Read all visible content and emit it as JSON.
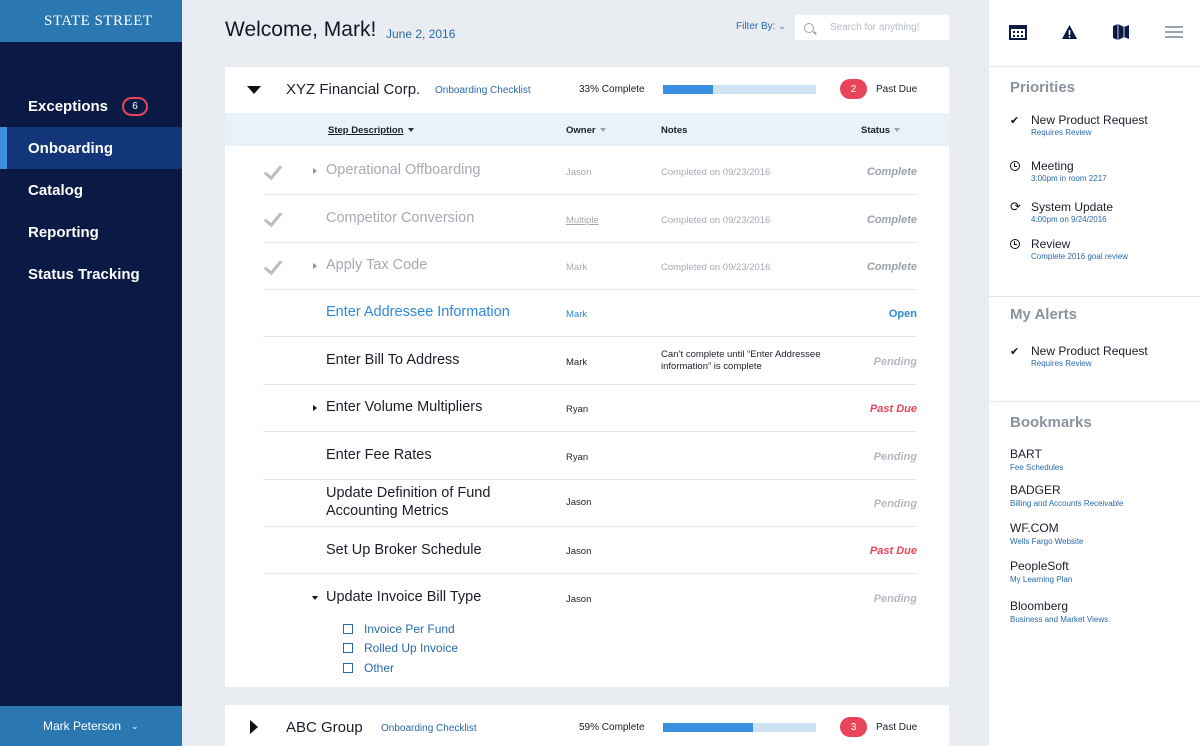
{
  "sidebar": {
    "logo": "STATE STREET",
    "items": [
      {
        "label": "Exceptions",
        "badge": "6"
      },
      {
        "label": "Onboarding"
      },
      {
        "label": "Catalog"
      },
      {
        "label": "Reporting"
      },
      {
        "label": "Status Tracking"
      }
    ],
    "active_item": "Onboarding",
    "user": "Mark Peterson"
  },
  "header": {
    "welcome": "Welcome, Mark!",
    "date": "June 2, 2016",
    "filter_label": "Filter By:",
    "search_placeholder": "Search for anything!"
  },
  "cards": [
    {
      "company": "XYZ Financial Corp.",
      "checklist_link": "Onboarding Checklist",
      "progress_text": "33% Complete",
      "progress": 0.33,
      "past_due_count": "2",
      "past_due_label": "Past Due",
      "expanded": true
    },
    {
      "company": "ABC Group",
      "checklist_link": "Onboarding Checklist",
      "progress_text": "59% Complete",
      "progress": 0.59,
      "past_due_count": "3",
      "past_due_label": "Past Due",
      "expanded": false
    }
  ],
  "table": {
    "columns": {
      "step": "Step Description",
      "owner": "Owner",
      "notes": "Notes",
      "status": "Status"
    },
    "rows": [
      {
        "step": "Operational Offboarding",
        "owner": "Jason",
        "notes": "Completed on 09/23/2016",
        "status": "Complete"
      },
      {
        "step": "Competitor Conversion",
        "owner": "Multiple",
        "notes": "Completed on 09/23/2016",
        "status": "Complete"
      },
      {
        "step": "Apply Tax Code",
        "owner": "Mark",
        "notes": "Completed on 09/23/2016",
        "status": "Complete"
      },
      {
        "step": "Enter Addressee Information",
        "owner": "Mark",
        "notes": "",
        "status": "Open"
      },
      {
        "step": "Enter Bill To Address",
        "owner": "Mark",
        "notes": "Can’t complete until “Enter Addressee information” is complete",
        "status": "Pending"
      },
      {
        "step": "Enter Volume Multipliers",
        "owner": "Ryan",
        "notes": "",
        "status": "Past Due"
      },
      {
        "step": "Enter Fee Rates",
        "owner": "Ryan",
        "notes": "",
        "status": "Pending"
      },
      {
        "step": "Update Definition of Fund Accounting Metrics",
        "owner": "Jason",
        "notes": "",
        "status": "Pending"
      },
      {
        "step": "Set Up Broker Schedule",
        "owner": "Jason",
        "notes": "",
        "status": "Past Due"
      },
      {
        "step": "Update Invoice Bill Type",
        "owner": "Jason",
        "notes": "",
        "status": "Pending"
      }
    ],
    "sub_options": [
      "Invoice Per Fund",
      "Rolled Up Invoice",
      "Other"
    ]
  },
  "right_panel": {
    "icons": [
      "calendar-icon",
      "alert-icon",
      "map-icon",
      "menu-icon"
    ],
    "priorities_title": "Priorities",
    "priorities": [
      {
        "icon": "check-icon",
        "title": "New Product Request",
        "sub": "Requires Review"
      },
      {
        "icon": "clock-icon",
        "title": "Meeting",
        "sub": "3:00pm in room 2217"
      },
      {
        "icon": "sync-icon",
        "title": "System Update",
        "sub": "4:00pm on 9/24/2016"
      },
      {
        "icon": "clock-icon",
        "title": "Review",
        "sub": "Complete 2016 goal review"
      }
    ],
    "alerts_title": "My Alerts",
    "alerts": [
      {
        "icon": "check-icon",
        "title": "New Product Request",
        "sub": "Requires Review"
      }
    ],
    "bookmarks_title": "Bookmarks",
    "bookmarks": [
      {
        "title": "BART",
        "sub": "Fee Schedules"
      },
      {
        "title": "BADGER",
        "sub": "Billing and Accounts Receivable"
      },
      {
        "title": "WF.COM",
        "sub": "Wells Fargo Website"
      },
      {
        "title": "PeopleSoft",
        "sub": "My Learning Plan"
      },
      {
        "title": "Bloomberg",
        "sub": "Business and Market Views"
      }
    ]
  },
  "colors": {
    "sidebar": "#0b1a45",
    "accent": "#2b77b2",
    "link": "#2b6aa8",
    "open": "#2f8adb",
    "past_due": "#e8445a",
    "progress_fill": "#3b8fe0",
    "progress_track": "#cfe2f4"
  }
}
